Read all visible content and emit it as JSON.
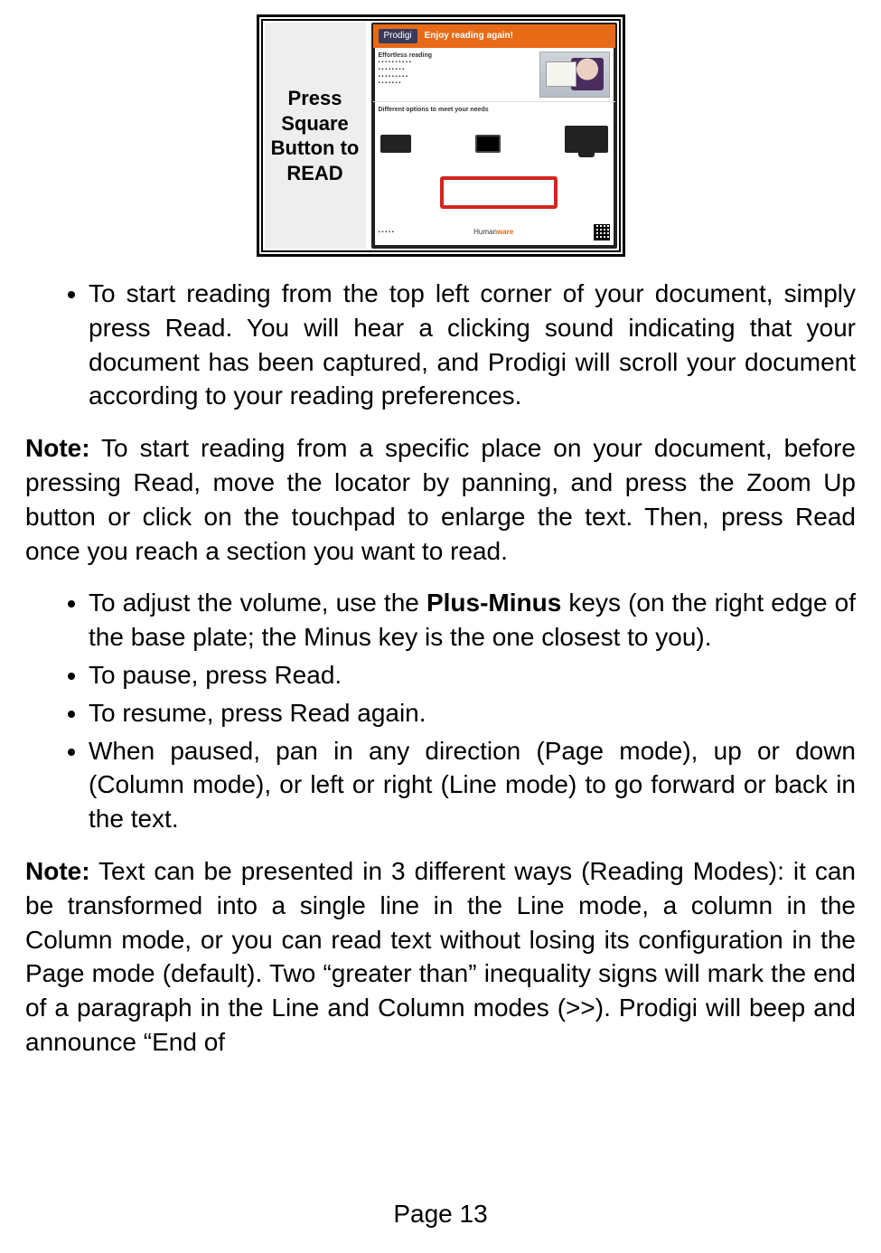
{
  "figure": {
    "left_caption": "Press Square Button to READ",
    "brochure": {
      "brand": "Prodigi",
      "tagline": "Enjoy reading again!",
      "headline": "Effortless reading",
      "options_heading": "Different options to meet your needs",
      "footer_brand_prefix": "Human",
      "footer_brand_suffix": "ware"
    }
  },
  "bullets1": [
    "To start reading from the top left corner of your document, simply press Read. You will hear a clicking sound indicating that your document has been captured, and Prodigi will scroll your document according to your reading preferences."
  ],
  "note1": {
    "label": "Note:",
    "text": " To start reading from a specific place on your document, before pressing Read, move the locator by panning, and press the Zoom Up button or click on the touchpad to enlarge the text. Then, press Read once you reach a section you want to read."
  },
  "bullets2": {
    "item1_pre": "To adjust the volume, use the ",
    "item1_bold": "Plus-Minus",
    "item1_post": " keys (on the right edge of the base plate; the Minus key is the one closest to you).",
    "item2": "To pause, press Read.",
    "item3": "To resume, press Read again.",
    "item4": "When paused, pan in any direction (Page mode), up or down (Column mode), or left or right (Line mode) to go forward or back in the text."
  },
  "note2": {
    "label": "Note:",
    "text": " Text can be presented in 3 different ways (Reading Modes): it can be transformed into a single line in the Line mode, a column in the Column mode, or you can read text without losing its configuration in the Page mode (default). Two “greater than” inequality signs will mark the end of a paragraph in the Line and Column modes (>>). Prodigi will beep and announce “End of"
  },
  "page_number": "Page 13"
}
